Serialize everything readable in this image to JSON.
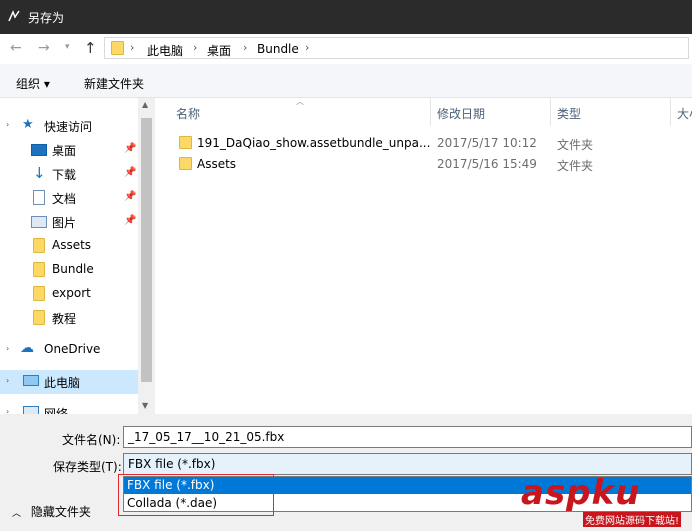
{
  "window": {
    "title": "另存为"
  },
  "address": {
    "crumbs": [
      "此电脑",
      "桌面",
      "Bundle"
    ]
  },
  "toolbar": {
    "organize_label": "组织 ▾",
    "new_folder_label": "新建文件夹"
  },
  "nav": {
    "quick_access": "快速访问",
    "items": [
      "桌面",
      "下载",
      "文档",
      "图片",
      "Assets",
      "Bundle",
      "export",
      "教程"
    ],
    "onedrive": "OneDrive",
    "this_pc": "此电脑",
    "network": "网络"
  },
  "columns": {
    "name": "名称",
    "date": "修改日期",
    "type": "类型",
    "size": "大小"
  },
  "files": [
    {
      "name": "191_DaQiao_show.assetbundle_unpa...",
      "date": "2017/5/17 10:12",
      "type": "文件夹"
    },
    {
      "name": "Assets",
      "date": "2017/5/16 15:49",
      "type": "文件夹"
    }
  ],
  "form": {
    "filename_label": "文件名(N):",
    "filename_value": "_17_05_17__10_21_05.fbx",
    "filetype_label": "保存类型(T):",
    "filetype_value": "FBX file (*.fbx)",
    "options": [
      "FBX file (*.fbx)",
      "Collada (*.dae)"
    ],
    "hide_folders_label": "隐藏文件夹"
  },
  "watermark": {
    "brand": "aspku",
    "sub": "免费网站源码下载站!"
  }
}
